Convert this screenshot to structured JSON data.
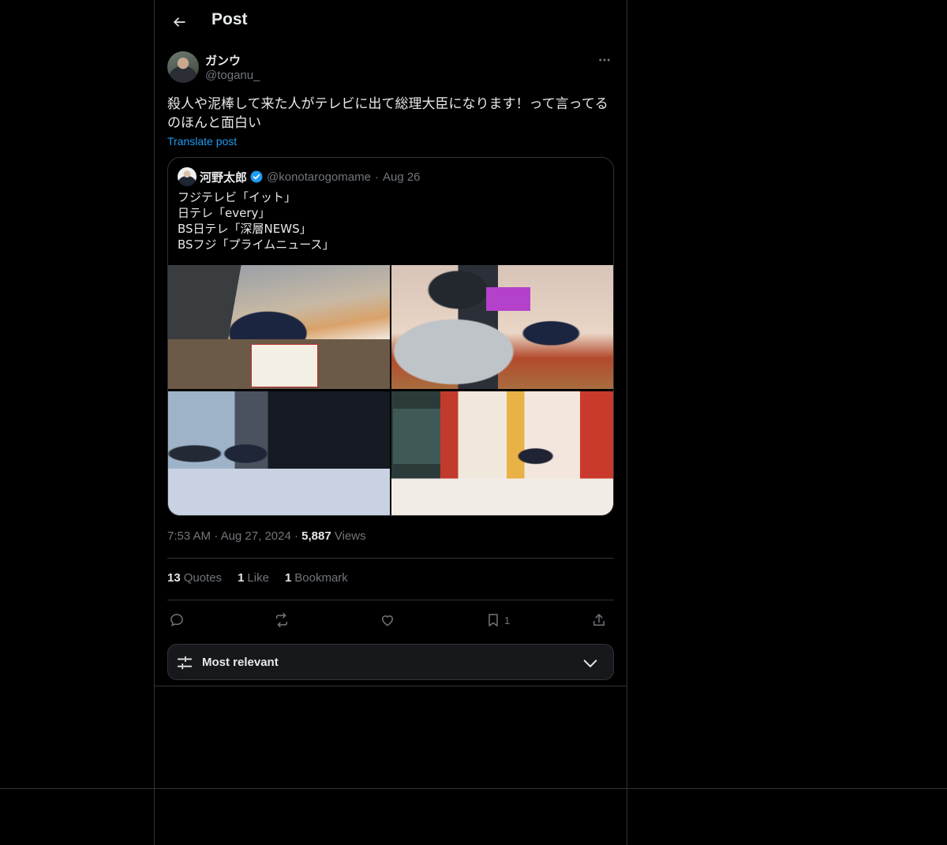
{
  "header": {
    "title": "Post"
  },
  "post": {
    "author_name": "ガンウ",
    "author_handle": "@toganu_",
    "text": "殺人や泥棒して来た人がテレビに出て総理大臣になります！って言ってるのほんと面白い",
    "translate_label": "Translate post",
    "time": "7:53 AM",
    "date": "Aug 27, 2024",
    "views_count": "5,887",
    "views_label": "Views"
  },
  "quote": {
    "name": "河野太郎",
    "handle": "@konotarogomame",
    "date": "Aug 26",
    "lines": [
      "フジテレビ「イット」",
      "日テレ「every」",
      "BS日テレ「深層NEWS」",
      "BSフジ「プライムニュース」"
    ]
  },
  "stats": {
    "quotes_count": "13",
    "quotes_label": "Quotes",
    "likes_count": "1",
    "likes_label": "Like",
    "bookmarks_count": "1",
    "bookmarks_label": "Bookmark"
  },
  "actions": {
    "bookmark_count": "1"
  },
  "sort": {
    "label": "Most relevant"
  },
  "colors": {
    "background": "#000000",
    "border": "#2f3336",
    "link": "#1d9bf0",
    "muted": "#71767b",
    "text": "#e7e9ea"
  },
  "icons": [
    "back-arrow-icon",
    "more-icon",
    "verified-icon",
    "reply-icon",
    "repost-icon",
    "like-icon",
    "bookmark-icon",
    "share-icon",
    "sliders-icon",
    "chevron-down-icon"
  ]
}
